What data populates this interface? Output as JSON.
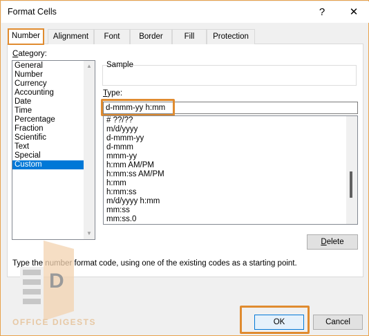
{
  "window": {
    "title": "Format Cells",
    "help_glyph": "?",
    "close_glyph": "✕"
  },
  "tabs": [
    {
      "label": "Number",
      "active": true
    },
    {
      "label": "Alignment",
      "active": false
    },
    {
      "label": "Font",
      "active": false
    },
    {
      "label": "Border",
      "active": false
    },
    {
      "label": "Fill",
      "active": false
    },
    {
      "label": "Protection",
      "active": false
    }
  ],
  "category": {
    "label_first": "C",
    "label_rest": "ategory:",
    "items": [
      "General",
      "Number",
      "Currency",
      "Accounting",
      "Date",
      "Time",
      "Percentage",
      "Fraction",
      "Scientific",
      "Text",
      "Special",
      "Custom"
    ],
    "selected": "Custom"
  },
  "sample": {
    "label": "Sample"
  },
  "type": {
    "label_first": "T",
    "label_rest": "ype:",
    "value": "d-mmm-yy h:mm",
    "items": [
      "# ??/??",
      "m/d/yyyy",
      "d-mmm-yy",
      "d-mmm",
      "mmm-yy",
      "h:mm AM/PM",
      "h:mm:ss AM/PM",
      "h:mm",
      "h:mm:ss",
      "m/d/yyyy h:mm",
      "mm:ss",
      "mm:ss.0"
    ]
  },
  "buttons": {
    "delete_first": "D",
    "delete_rest": "elete",
    "ok": "OK",
    "cancel": "Cancel"
  },
  "hint": "Type the number format code, using one of the existing codes as a starting point.",
  "watermark": {
    "text": "OFFICE DIGESTS",
    "mark": "D"
  },
  "colors": {
    "highlight": "#e08b2f",
    "selection": "#0078d7"
  }
}
